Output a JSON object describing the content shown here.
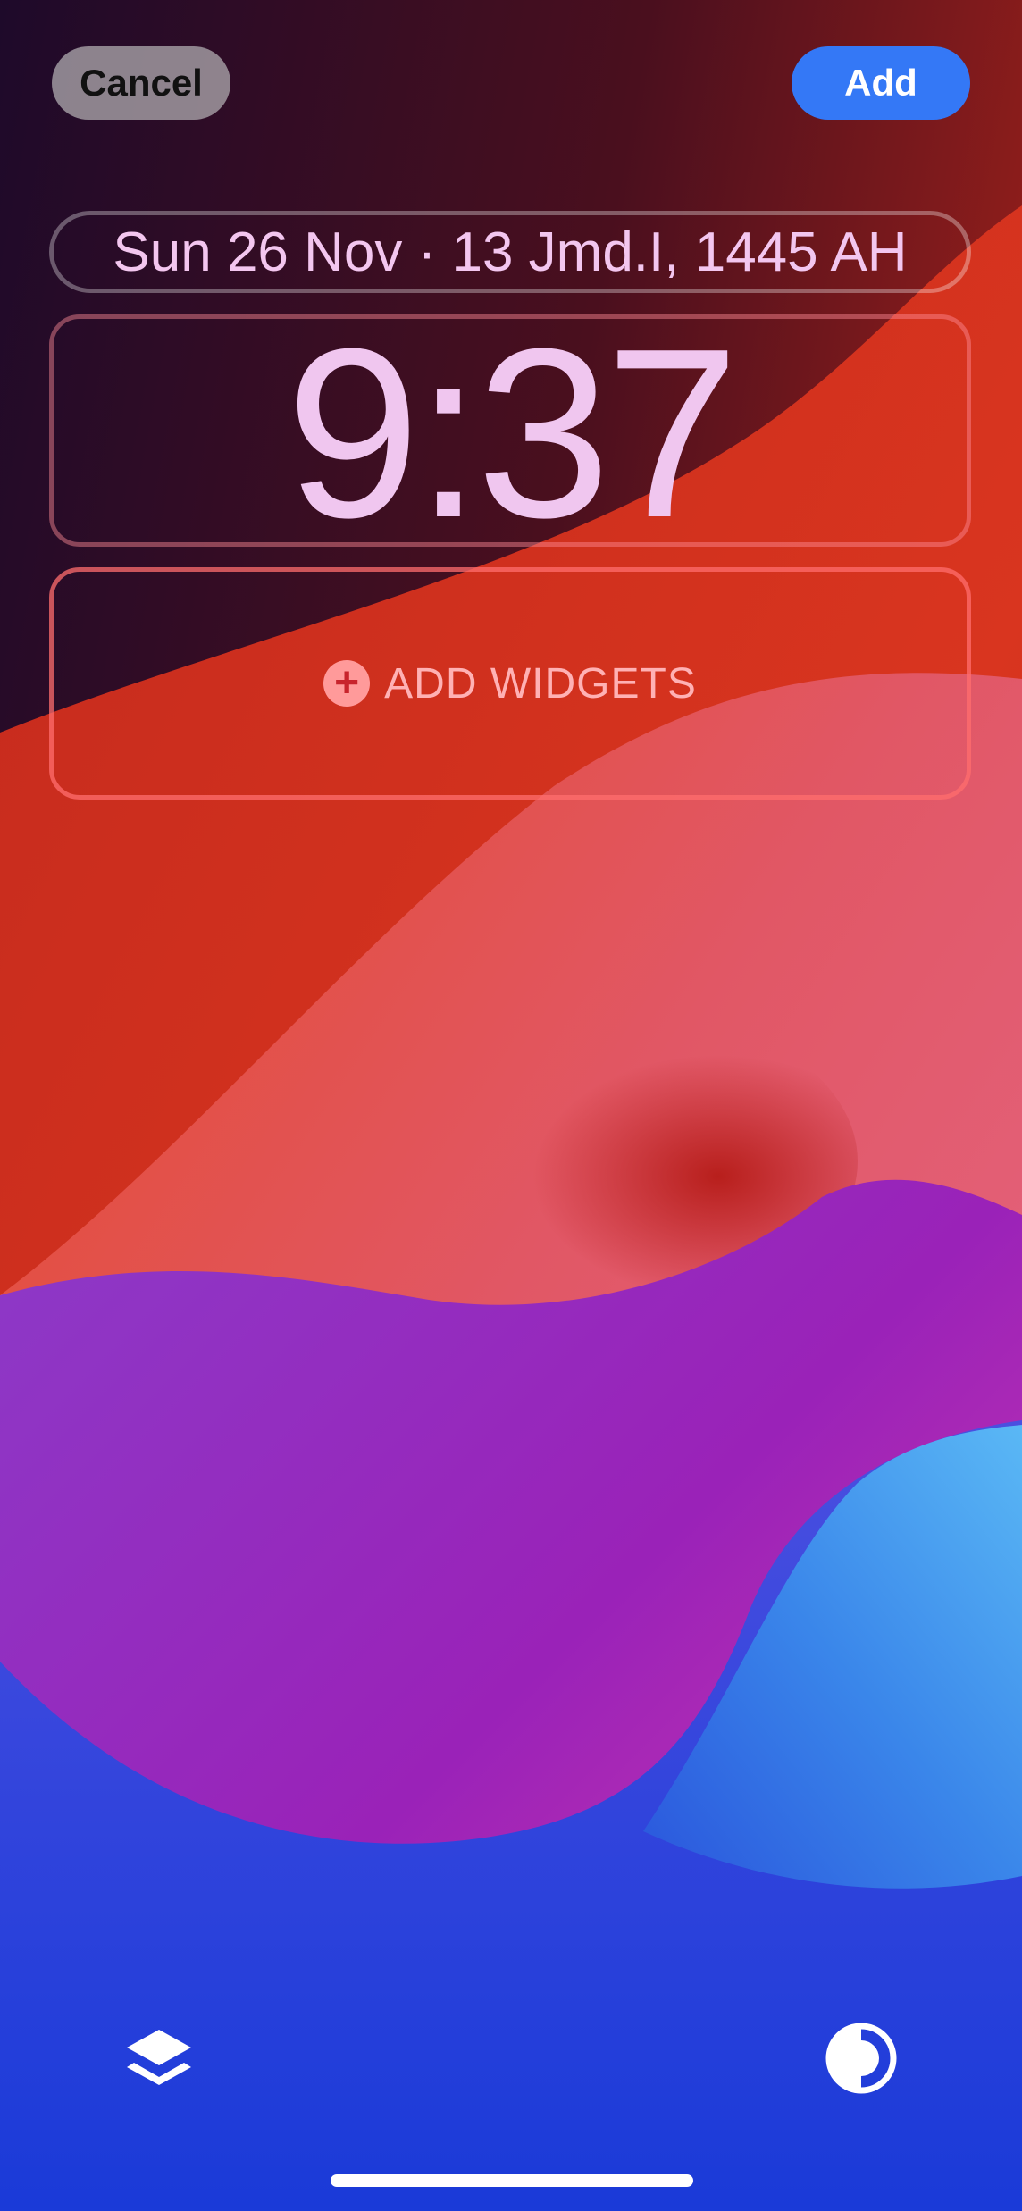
{
  "header": {
    "cancel_label": "Cancel",
    "add_label": "Add"
  },
  "lockscreen": {
    "date": "Sun 26 Nov · 13 Jmd.I, 1445 AH",
    "time": "9:37",
    "add_widgets_label": "ADD WIDGETS"
  },
  "bottom_bar": {
    "left_icon": "layers-icon",
    "right_icon": "contrast-icon"
  },
  "colors": {
    "add_button": "#3478f6",
    "cancel_button": "#aaa5aa",
    "clock_text": "#f0c6ef",
    "widgets_text": "#ffb1b4"
  }
}
